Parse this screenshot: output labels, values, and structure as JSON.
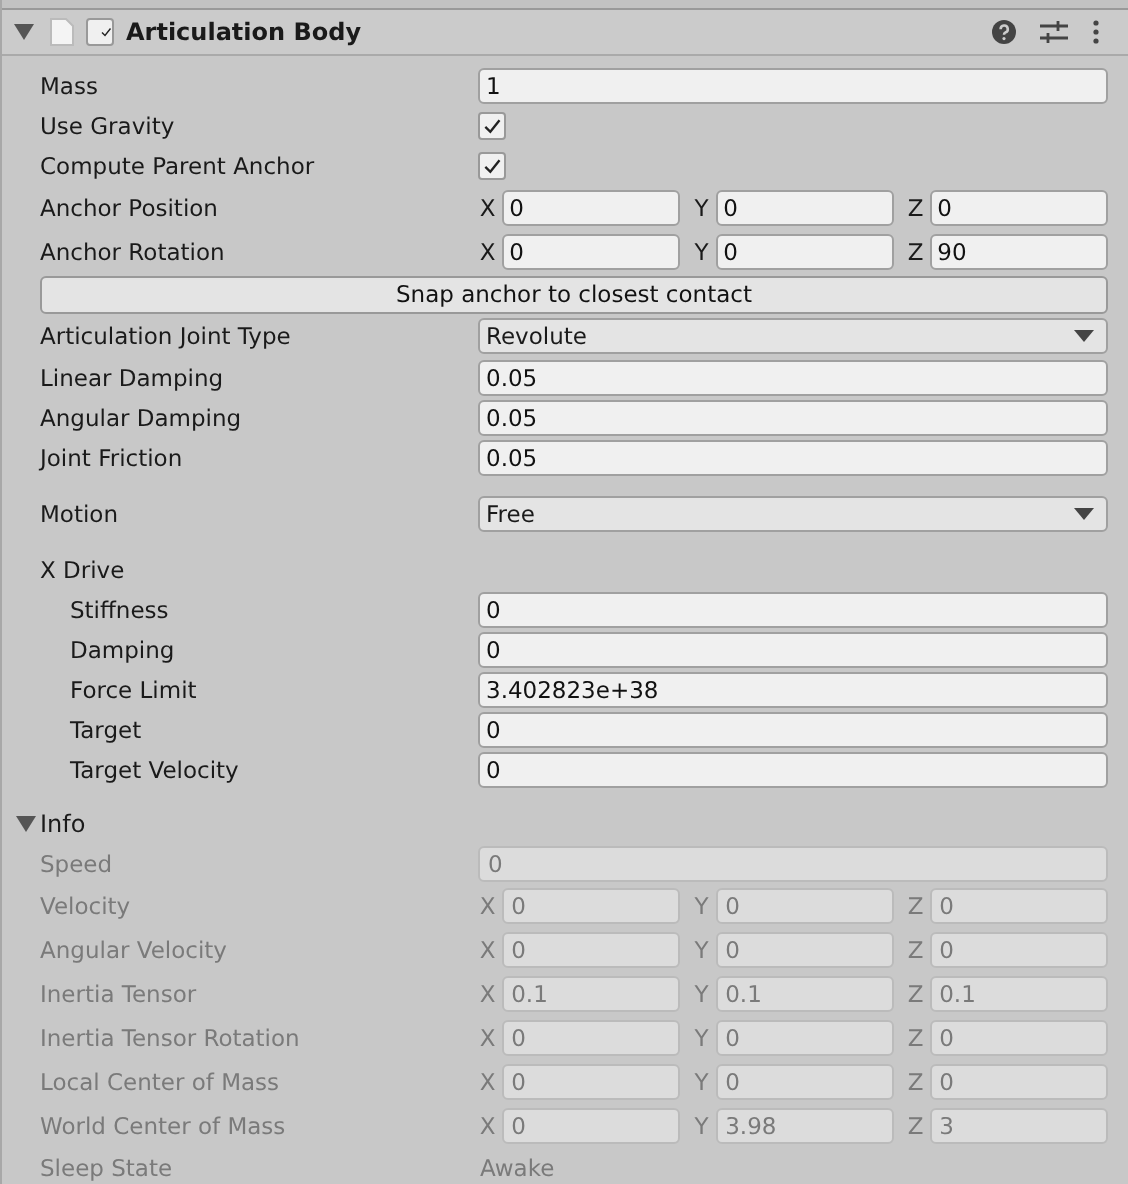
{
  "component": {
    "title": "Articulation Body",
    "enabled": true,
    "expanded": true
  },
  "groups": [
    [
      {
        "kind": "number",
        "label": "Mass",
        "value": "1"
      },
      {
        "kind": "checkbox",
        "label": "Use Gravity",
        "checked": true
      },
      {
        "kind": "checkbox",
        "label": "Compute Parent Anchor",
        "checked": true
      },
      {
        "kind": "vector3",
        "label": "Anchor Position",
        "values": [
          {
            "axis": "X",
            "value": "0"
          },
          {
            "axis": "Y",
            "value": "0"
          },
          {
            "axis": "Z",
            "value": "0"
          }
        ]
      },
      {
        "kind": "vector3",
        "label": "Anchor Rotation",
        "values": [
          {
            "axis": "X",
            "value": "0"
          },
          {
            "axis": "Y",
            "value": "0"
          },
          {
            "axis": "Z",
            "value": "90"
          }
        ]
      },
      {
        "kind": "button",
        "label": "Snap anchor to closest contact"
      },
      {
        "kind": "dropdown",
        "label": "Articulation Joint Type",
        "value": "Revolute"
      },
      {
        "kind": "number",
        "label": "Linear Damping",
        "value": "0.05"
      },
      {
        "kind": "number",
        "label": "Angular Damping",
        "value": "0.05"
      },
      {
        "kind": "number",
        "label": "Joint Friction",
        "value": "0.05"
      }
    ],
    [
      {
        "kind": "dropdown",
        "label": "Motion",
        "value": "Free"
      }
    ],
    [
      {
        "kind": "label",
        "label": "X Drive",
        "children": [
          {
            "kind": "number",
            "label": "Stiffness",
            "value": "0"
          },
          {
            "kind": "number",
            "label": "Damping",
            "value": "0"
          },
          {
            "kind": "number",
            "label": "Force Limit",
            "value": "3.402823e+38"
          },
          {
            "kind": "number",
            "label": "Target",
            "value": "0"
          },
          {
            "kind": "number",
            "label": "Target Velocity",
            "value": "0"
          }
        ]
      }
    ]
  ],
  "info": {
    "label": "Info",
    "expanded": true,
    "disabled": true,
    "fields": [
      {
        "kind": "number",
        "label": "Speed",
        "value": "0"
      },
      {
        "kind": "vector3",
        "label": "Velocity",
        "values": [
          {
            "axis": "X",
            "value": "0"
          },
          {
            "axis": "Y",
            "value": "0"
          },
          {
            "axis": "Z",
            "value": "0"
          }
        ]
      },
      {
        "kind": "vector3",
        "label": "Angular Velocity",
        "values": [
          {
            "axis": "X",
            "value": "0"
          },
          {
            "axis": "Y",
            "value": "0"
          },
          {
            "axis": "Z",
            "value": "0"
          }
        ]
      },
      {
        "kind": "vector3",
        "label": "Inertia Tensor",
        "values": [
          {
            "axis": "X",
            "value": "0.1"
          },
          {
            "axis": "Y",
            "value": "0.1"
          },
          {
            "axis": "Z",
            "value": "0.1"
          }
        ]
      },
      {
        "kind": "vector3",
        "label": "Inertia Tensor Rotation",
        "values": [
          {
            "axis": "X",
            "value": "0"
          },
          {
            "axis": "Y",
            "value": "0"
          },
          {
            "axis": "Z",
            "value": "0"
          }
        ]
      },
      {
        "kind": "vector3",
        "label": "Local Center of Mass",
        "values": [
          {
            "axis": "X",
            "value": "0"
          },
          {
            "axis": "Y",
            "value": "0"
          },
          {
            "axis": "Z",
            "value": "0"
          }
        ]
      },
      {
        "kind": "vector3",
        "label": "World Center of Mass",
        "values": [
          {
            "axis": "X",
            "value": "0"
          },
          {
            "axis": "Y",
            "value": "3.98"
          },
          {
            "axis": "Z",
            "value": "3"
          }
        ]
      },
      {
        "kind": "text",
        "label": "Sleep State",
        "value": "Awake"
      }
    ]
  }
}
